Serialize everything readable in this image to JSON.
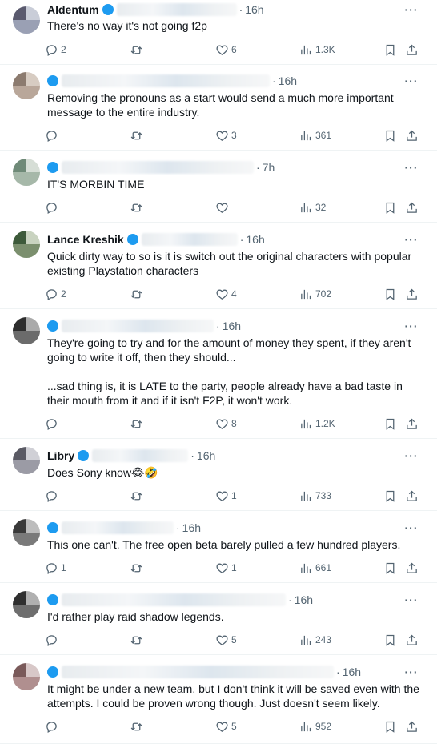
{
  "replies": [
    {
      "name": "Aldentum",
      "handle": "",
      "time": "16h",
      "text": "There's no way it's not going f2p",
      "replies": "2",
      "retweets": "",
      "likes": "6",
      "views": "1.3K"
    },
    {
      "name": "",
      "handle": "",
      "time": "16h",
      "text": "Removing the pronouns as a start would send a much more important message to the entire industry.",
      "replies": "",
      "retweets": "",
      "likes": "3",
      "views": "361"
    },
    {
      "name": "",
      "handle": "",
      "time": "7h",
      "text": "IT'S MORBIN TIME",
      "replies": "",
      "retweets": "",
      "likes": "",
      "views": "32"
    },
    {
      "name": "Lance Kreshik",
      "handle": "",
      "time": "16h",
      "text": "Quick dirty way to so is it is switch out the original characters with popular existing Playstation characters",
      "replies": "2",
      "retweets": "",
      "likes": "4",
      "views": "702"
    },
    {
      "name": "",
      "handle": "",
      "time": "16h",
      "text": "They're going to try and for the amount of money they spent, if they aren't going to write it off, then they should...\n\n...sad thing is, it is LATE to the party, people already have a bad taste in their mouth from it and if it isn't F2P, it won't work.",
      "replies": "",
      "retweets": "",
      "likes": "8",
      "views": "1.2K"
    },
    {
      "name": "Libry",
      "handle": "",
      "time": "16h",
      "text": "Does Sony know😂🤣",
      "replies": "",
      "retweets": "",
      "likes": "1",
      "views": "733"
    },
    {
      "name": "",
      "handle": "",
      "time": "16h",
      "text": "This one can't. The free open beta barely pulled a few hundred players.",
      "replies": "1",
      "retweets": "",
      "likes": "1",
      "views": "661"
    },
    {
      "name": "",
      "handle": "",
      "time": "16h",
      "text": "I'd rather play raid shadow legends.",
      "replies": "",
      "retweets": "",
      "likes": "5",
      "views": "243"
    },
    {
      "name": "",
      "handle": "",
      "time": "16h",
      "text": "It might be under a new team, but I don't think it will be saved even with the attempts. I could be proven wrong though. Just doesn't seem likely.",
      "replies": "",
      "retweets": "",
      "likes": "5",
      "views": "952"
    }
  ],
  "icons": {
    "more": "more-icon",
    "reply": "reply-icon",
    "retweet": "retweet-icon",
    "like": "heart-icon",
    "views": "views-icon",
    "bookmark": "bookmark-icon",
    "share": "share-icon"
  },
  "colors": {
    "text": "#0f1419",
    "muted": "#536471",
    "verified": "#1d9bf0",
    "divider": "#eff3f4"
  }
}
